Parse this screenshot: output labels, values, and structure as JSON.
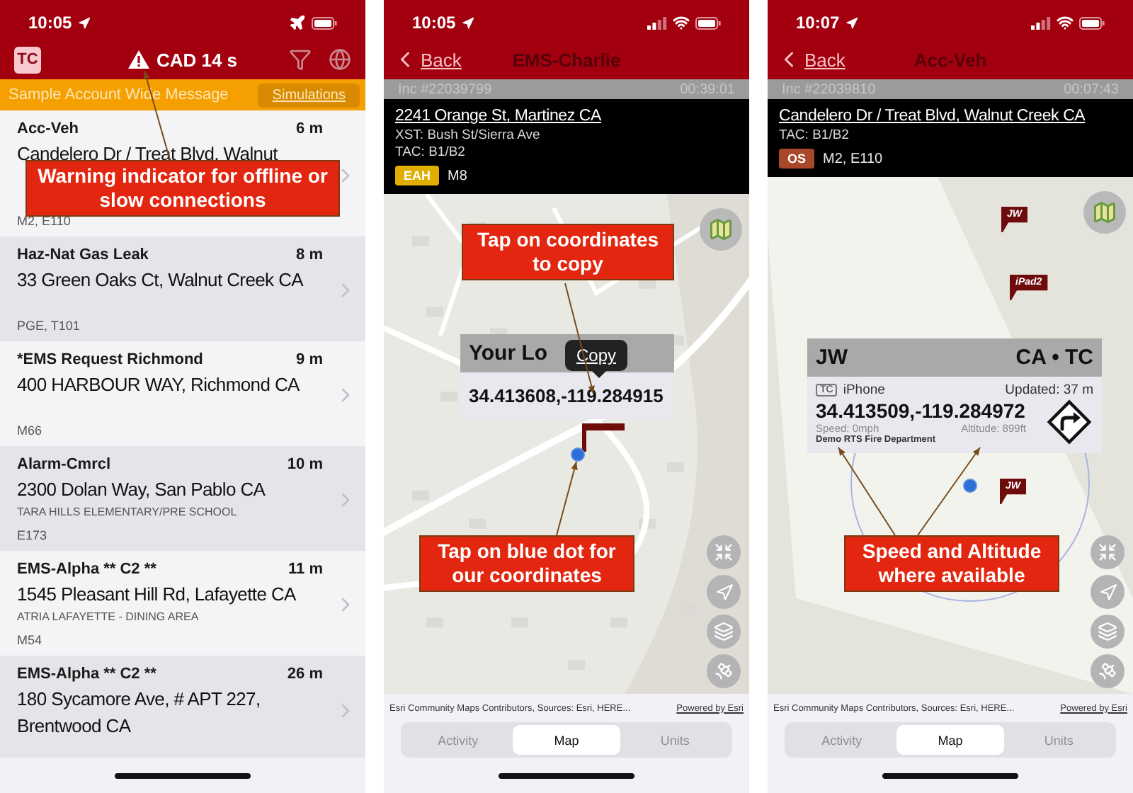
{
  "screens": [
    {
      "kind": "incident_list",
      "status_bar": {
        "time": "10:05",
        "airplane_mode": true
      },
      "header": {
        "badge": "TC",
        "status": "CAD 14 s",
        "warning": true
      },
      "message_bar": {
        "text": "Sample Account Wide Message",
        "button": "Simulations"
      },
      "incidents": [
        {
          "type": "Acc-Veh",
          "age": "6 m",
          "address": "Candelero Dr / Treat Blvd, Walnut",
          "units": "M2, E110"
        },
        {
          "type": "Haz-Nat Gas Leak",
          "age": "8 m",
          "address": "33 Green Oaks Ct, Walnut Creek CA",
          "units": "PGE, T101"
        },
        {
          "type": "*EMS Request Richmond",
          "age": "9 m",
          "address": "400 HARBOUR WAY, Richmond CA",
          "units": "M66"
        },
        {
          "type": "Alarm-Cmrcl",
          "age": "10 m",
          "address": "2300 Dolan Way, San Pablo CA",
          "location": "TARA HILLS ELEMENTARY/PRE SCHOOL",
          "units": "E173"
        },
        {
          "type": "EMS-Alpha ** C2 **",
          "age": "11 m",
          "address": "1545 Pleasant Hill Rd, Lafayette CA",
          "location": "ATRIA LAFAYETTE - DINING AREA",
          "units": "M54"
        },
        {
          "type": "EMS-Alpha ** C2 **",
          "age": "26 m",
          "address": "180 Sycamore Ave, # APT 227, Brentwood CA"
        }
      ],
      "callouts": [
        "Warning indicator for offline or slow connections"
      ]
    },
    {
      "kind": "incident_map",
      "status_bar": {
        "time": "10:05",
        "airplane_mode": false
      },
      "nav": {
        "back": "Back",
        "title": "EMS-Charlie"
      },
      "incident": {
        "number": "Inc #22039799",
        "elapsed": "00:39:01",
        "address": "2241 Orange St, Martinez CA",
        "details": [
          "XST: Bush St/Sierra Ave",
          "TAC: B1/B2"
        ],
        "badge": {
          "label": "EAH",
          "color": "#e0ae00"
        },
        "units": "M8"
      },
      "map": {
        "popup": {
          "kind": "location",
          "title": "Your Lo",
          "tooltip": "Copy",
          "coordinates": "34.413608,-119.284915"
        }
      },
      "attribution": {
        "text": "Esri Community Maps Contributors, Sources: Esri, HERE...",
        "link": "Powered by Esri"
      },
      "tabs": [
        {
          "label": "Activity",
          "selected": false
        },
        {
          "label": "Map",
          "selected": true
        },
        {
          "label": "Units",
          "selected": false
        }
      ],
      "callouts": [
        "Tap on coordinates to copy",
        "Tap on blue dot for our coordinates"
      ]
    },
    {
      "kind": "incident_map",
      "status_bar": {
        "time": "10:07",
        "airplane_mode": false
      },
      "nav": {
        "back": "Back",
        "title": "Acc-Veh"
      },
      "incident": {
        "number": "Inc #22039810",
        "elapsed": "00:07:43",
        "address": "Candelero Dr / Treat Blvd, Walnut Creek CA",
        "details": [
          "TAC: B1/B2"
        ],
        "badge": {
          "label": "OS",
          "color": "#a9472a"
        },
        "units": "M2, E110"
      },
      "map": {
        "markers": [
          "JW",
          "iPad2",
          "JW"
        ],
        "popup": {
          "kind": "device",
          "title": "JW",
          "region": "CA • TC",
          "badge": "TC",
          "device": "iPhone",
          "updated": "Updated: 37 m",
          "coordinates": "34.413509,-119.284972",
          "speed": "Speed: 0mph",
          "altitude": "Altitude: 899ft",
          "agency": "Demo RTS Fire Department"
        }
      },
      "attribution": {
        "text": "Esri Community Maps Contributors, Sources: Esri, HERE...",
        "link": "Powered by Esri"
      },
      "tabs": [
        {
          "label": "Activity",
          "selected": false
        },
        {
          "label": "Map",
          "selected": true
        },
        {
          "label": "Units",
          "selected": false
        }
      ],
      "callouts": [
        "Speed and Altitude where available"
      ]
    }
  ]
}
